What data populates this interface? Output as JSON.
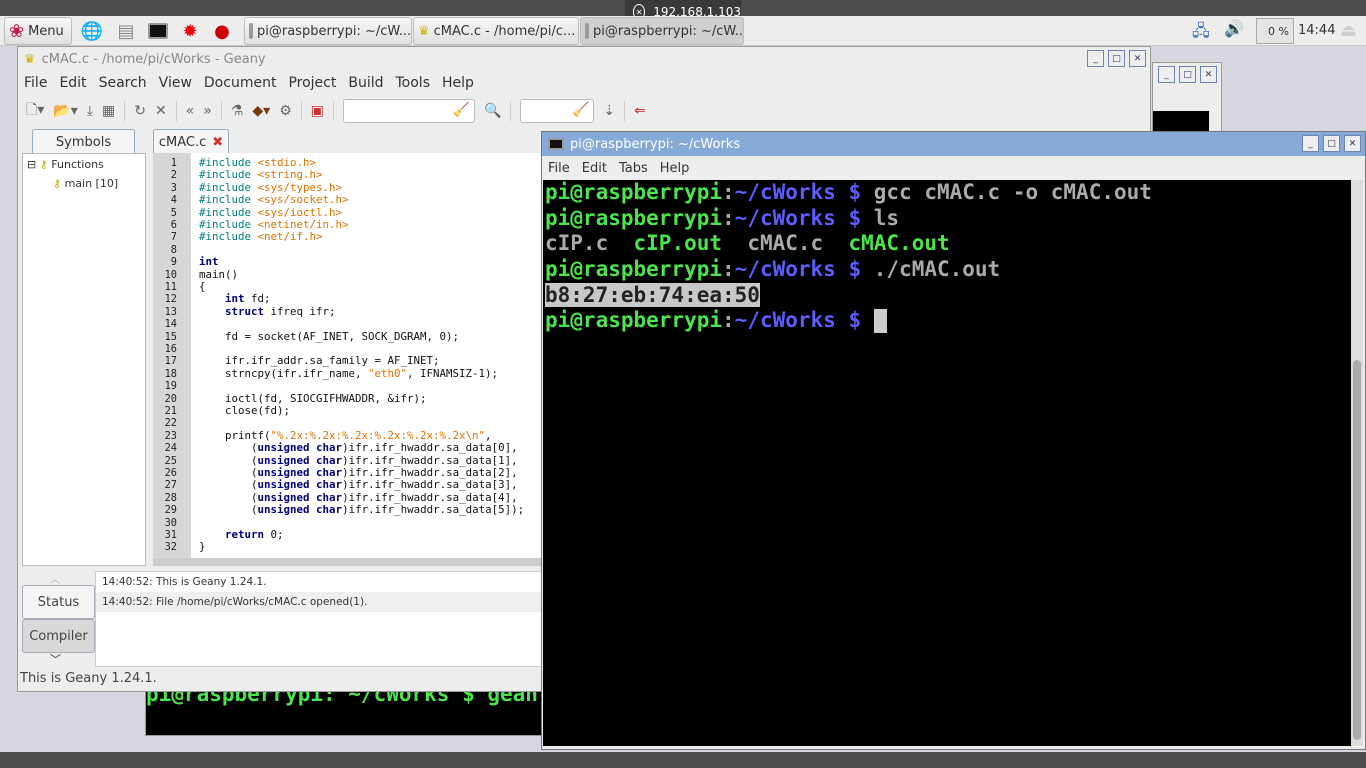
{
  "vnc_address": "192.168.1.103",
  "taskbar": {
    "menu_label": "Menu",
    "launchers": [
      "web-browser-icon",
      "file-manager-icon",
      "terminal-icon",
      "mathematica-icon",
      "wolfram-icon"
    ],
    "tasks": [
      {
        "label": "pi@raspberrypi: ~/cW..."
      },
      {
        "label": "cMAC.c - /home/pi/c..."
      },
      {
        "label": "pi@raspberrypi: ~/cW..."
      }
    ],
    "cpu": "0 %",
    "clock": "14:44"
  },
  "geany": {
    "title": "cMAC.c - /home/pi/cWorks - Geany",
    "menu": [
      "File",
      "Edit",
      "Search",
      "View",
      "Document",
      "Project",
      "Build",
      "Tools",
      "Help"
    ],
    "sidebar_tab": "Symbols",
    "file_tab": "cMAC.c",
    "symbols": {
      "group": "Functions",
      "items": [
        "main [10]"
      ]
    },
    "code": [
      "#include <stdio.h>",
      "#include <string.h>",
      "#include <sys/types.h>",
      "#include <sys/socket.h>",
      "#include <sys/ioctl.h>",
      "#include <netinet/in.h>",
      "#include <net/if.h>",
      "",
      "int",
      "main()",
      "{",
      "    int fd;",
      "    struct ifreq ifr;",
      "",
      "    fd = socket(AF_INET, SOCK_DGRAM, 0);",
      "",
      "    ifr.ifr_addr.sa_family = AF_INET;",
      "    strncpy(ifr.ifr_name, \"eth0\", IFNAMSIZ-1);",
      "",
      "    ioctl(fd, SIOCGIFHWADDR, &ifr);",
      "    close(fd);",
      "",
      "    printf(\"%.2x:%.2x:%.2x:%.2x:%.2x:%.2x\\n\",",
      "        (unsigned char)ifr.ifr_hwaddr.sa_data[0],",
      "        (unsigned char)ifr.ifr_hwaddr.sa_data[1],",
      "        (unsigned char)ifr.ifr_hwaddr.sa_data[2],",
      "        (unsigned char)ifr.ifr_hwaddr.sa_data[3],",
      "        (unsigned char)ifr.ifr_hwaddr.sa_data[4],",
      "        (unsigned char)ifr.ifr_hwaddr.sa_data[5]);",
      "",
      "    return 0;",
      "}"
    ],
    "msg_tabs": [
      "Status",
      "Compiler"
    ],
    "messages": [
      "14:40:52: This is Geany 1.24.1.",
      "14:40:52: File /home/pi/cWorks/cMAC.c opened(1)."
    ],
    "statusbar": "This is Geany 1.24.1."
  },
  "terminal": {
    "title": "pi@raspberrypi: ~/cWorks",
    "menu": [
      "File",
      "Edit",
      "Tabs",
      "Help"
    ],
    "prompt_user": "pi@raspberrypi",
    "prompt_path": "~/cWorks $",
    "lines": [
      {
        "type": "cmd",
        "cmd": "gcc cMAC.c -o cMAC.out"
      },
      {
        "type": "cmd",
        "cmd": "ls"
      },
      {
        "type": "ls",
        "items": [
          {
            "name": "cIP.c",
            "exec": false
          },
          {
            "name": "cIP.out",
            "exec": true
          },
          {
            "name": "cMAC.c",
            "exec": false
          },
          {
            "name": "cMAC.out",
            "exec": true
          }
        ]
      },
      {
        "type": "cmd",
        "cmd": "./cMAC.out"
      },
      {
        "type": "out",
        "text": "b8:27:eb:74:ea:50"
      },
      {
        "type": "cmd",
        "cmd": "",
        "cursor": true
      }
    ]
  },
  "bg_terminal": {
    "partial_prompt": "pi@raspberrypi: ~/cWorks $ gean"
  }
}
